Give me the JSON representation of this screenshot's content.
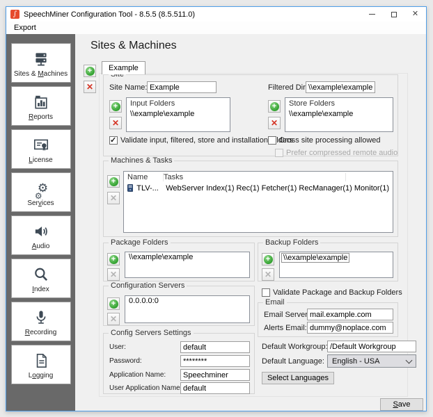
{
  "window": {
    "title": "SpeechMiner Configuration Tool - 8.5.5 (8.5.511.0)",
    "app_icon_glyph": "∫",
    "menu": {
      "export_label": "Export"
    },
    "accent_border_color": "#4f9ee8",
    "sidebar_color": "#696969",
    "app_icon_color": "#e64a2e"
  },
  "sidebar": {
    "items": [
      {
        "label": "Sites & Machines",
        "hotkey": 8,
        "icon": "servers-icon"
      },
      {
        "label": "Reports",
        "hotkey": 0,
        "icon": "bar-chart-icon"
      },
      {
        "label": "License",
        "hotkey": 0,
        "icon": "certificate-icon"
      },
      {
        "label": "Services",
        "hotkey": 3,
        "icon": "gears-icon"
      },
      {
        "label": "Audio",
        "hotkey": 0,
        "icon": "speaker-icon"
      },
      {
        "label": "Index",
        "hotkey": 0,
        "icon": "magnifier-icon"
      },
      {
        "label": "Recording",
        "hotkey": 0,
        "icon": "microphone-icon"
      },
      {
        "label": "Logging",
        "hotkey": 1,
        "icon": "document-icon"
      }
    ],
    "gear_glyph": "⚙"
  },
  "main": {
    "heading": "Sites & Machines",
    "tab_label": "Example",
    "site": {
      "legend": "Site",
      "site_name_label": "Site Name:",
      "site_name_value": "Example",
      "filtered_dir_label": "Filtered Dir:",
      "filtered_dir_value": "\\\\example\\example",
      "input_folders_header": "Input Folders",
      "input_folders_items": [
        "\\\\example\\example"
      ],
      "store_folders_header": "Store Folders",
      "store_folders_items": [
        "\\\\example\\example"
      ],
      "validate_folders_checkbox": "Validate input, filtered, store and installation folders",
      "cross_site_checkbox": "Cross site processing allowed",
      "prefer_compressed_checkbox": "Prefer compressed remote audio"
    },
    "machines": {
      "legend": "Machines & Tasks",
      "col_name": "Name",
      "col_tasks": "Tasks",
      "rows": [
        {
          "name": "TLV-...",
          "tasks": "WebServer Index(1) Rec(1) Fetcher(1) RecManager(1) Monitor(1)"
        }
      ]
    },
    "package_folders": {
      "legend": "Package Folders",
      "items": [
        "\\\\example\\example"
      ]
    },
    "backup_folders": {
      "legend": "Backup Folders",
      "items": [
        "\\\\example\\example"
      ]
    },
    "config_servers": {
      "legend": "Configuration Servers",
      "items": [
        "0.0.0.0:0"
      ]
    },
    "validate_backup_checkbox": "Validate Package and Backup Folders",
    "email": {
      "legend": "Email",
      "server_label": "Email Server:",
      "server_value": "mail.example.com",
      "alerts_label": "Alerts Email:",
      "alerts_value": "dummy@noplace.com"
    },
    "config_settings": {
      "legend": "Config Servers Settings",
      "user_label": "User:",
      "user_value": "default",
      "password_label": "Password:",
      "password_value": "********",
      "app_name_label": "Application Name:",
      "app_name_value": "Speechminer",
      "user_app_label": "User Application Name:",
      "user_app_value": "default"
    },
    "defaults": {
      "workgroup_label": "Default Workgroup:",
      "workgroup_value": "/Default Workgroup",
      "language_label": "Default Language:",
      "language_value": "English - USA",
      "select_languages_button": "Select Languages"
    },
    "save_button": {
      "label": "Save",
      "hotkey": 0
    }
  }
}
